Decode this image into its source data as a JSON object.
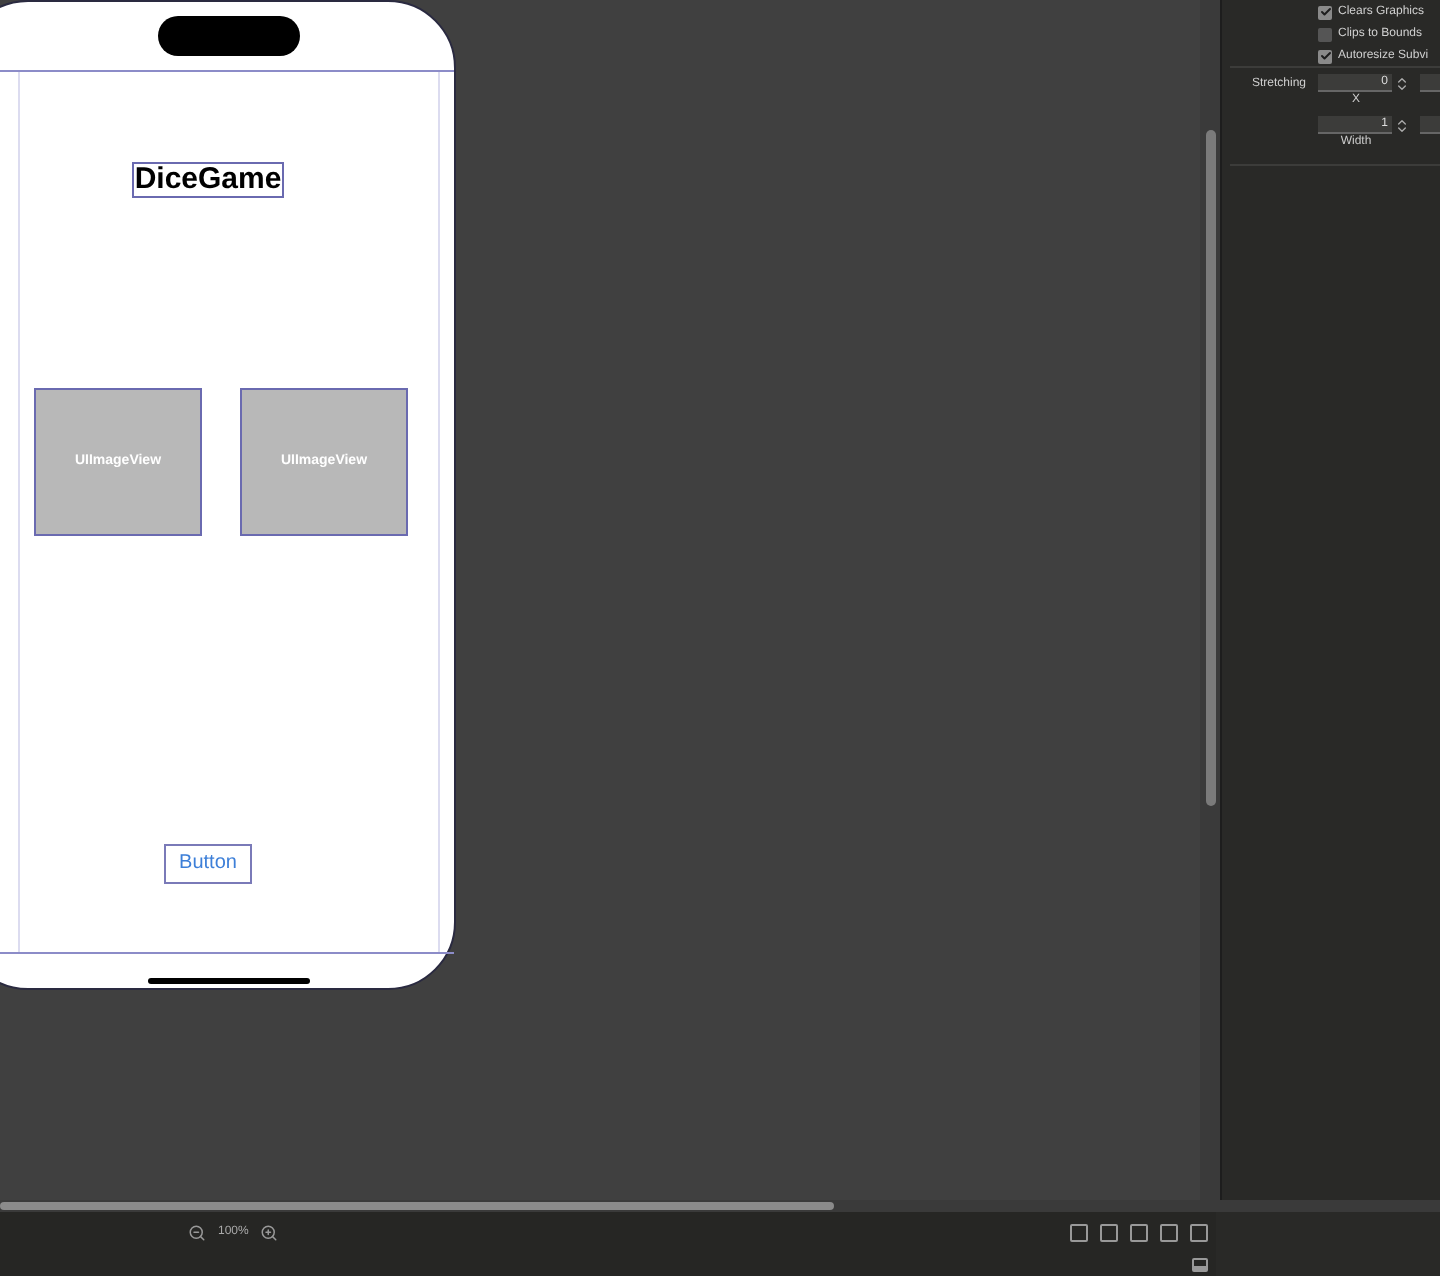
{
  "canvas": {
    "title_label": "DiceGame",
    "image_views": [
      {
        "label": "UIImageView"
      },
      {
        "label": "UIImageView"
      }
    ],
    "button": "Button"
  },
  "inspector": {
    "checkboxes": [
      {
        "label": "Clears Graphics",
        "checked": true
      },
      {
        "label": "Clips to Bounds",
        "checked": false
      },
      {
        "label": "Autoresize Subvi",
        "checked": true
      }
    ],
    "stretching": {
      "label": "Stretching",
      "fields": [
        {
          "value": "0",
          "caption": "X"
        },
        {
          "value": "1",
          "caption": "Width"
        }
      ]
    }
  },
  "bottom_bar": {
    "zoom": "100%"
  }
}
